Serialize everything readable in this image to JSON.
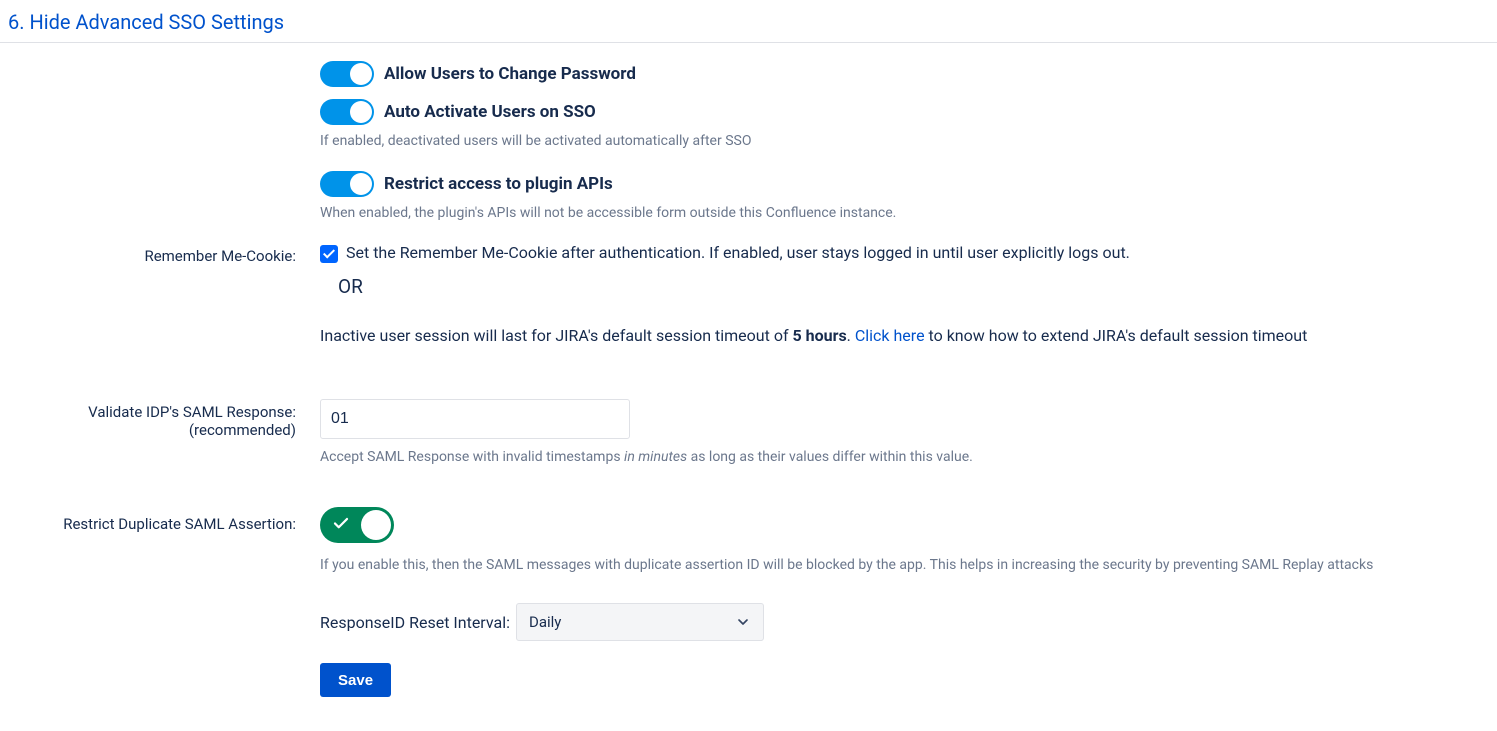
{
  "section": {
    "title": "6. Hide Advanced SSO Settings"
  },
  "toggles": {
    "allow_password_change": {
      "label": "Allow Users to Change Password",
      "state": true
    },
    "auto_activate": {
      "label": "Auto Activate Users on SSO",
      "state": true,
      "help": "If enabled, deactivated users will be activated automatically after SSO"
    },
    "restrict_api": {
      "label": "Restrict access to plugin APIs",
      "state": true,
      "help": "When enabled, the plugin's APIs will not be accessible form outside this Confluence instance."
    },
    "restrict_duplicate": {
      "state": true
    }
  },
  "remember_me": {
    "label": "Remember Me-Cookie:",
    "checkbox_text": "Set the Remember Me-Cookie after authentication. If enabled, user stays logged in until user explicitly logs out.",
    "or_text": "OR",
    "session_prefix": "Inactive user session will last for JIRA's default session timeout of ",
    "session_bold": "5 hours",
    "session_mid": ". ",
    "session_link": "Click here",
    "session_suffix": " to know how to extend JIRA's default session timeout"
  },
  "validate_idp": {
    "label_line1": "Validate IDP's SAML Response:",
    "label_line2": "(recommended)",
    "value": "01",
    "help_prefix": "Accept SAML Response with invalid timestamps ",
    "help_italic": "in minutes",
    "help_suffix": " as long as their values differ within this value."
  },
  "restrict_duplicate": {
    "label": "Restrict Duplicate SAML Assertion:",
    "help": "If you enable this, then the SAML messages with duplicate assertion ID will be blocked by the app. This helps in increasing the security by preventing SAML Replay attacks"
  },
  "interval": {
    "label": "ResponseID Reset Interval:",
    "value": "Daily"
  },
  "actions": {
    "save": "Save"
  }
}
